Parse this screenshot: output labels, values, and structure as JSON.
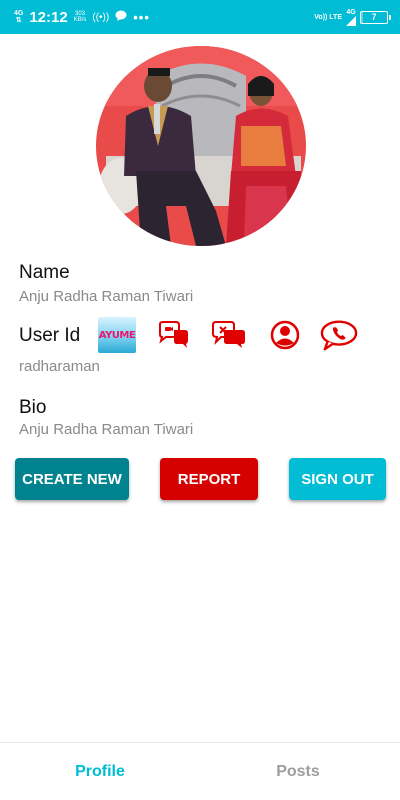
{
  "status_bar": {
    "network_left": "4G",
    "time": "12:12",
    "speed_value": "303",
    "speed_unit": "KB/s",
    "more_dots": "•••",
    "volte": "Vo)) LTE",
    "network_right": "4G",
    "battery": "7",
    "battery_level": 0.07
  },
  "profile": {
    "name_label": "Name",
    "name_value": "Anju Radha Raman Tiwari",
    "userid_label": "User Id",
    "userid_value": "radharaman",
    "bio_label": "Bio",
    "bio_value": "Anju Radha Raman Tiwari"
  },
  "icons": {
    "app_logo_text": "AYUME",
    "items": [
      "app-logo-icon",
      "video-chat-icon",
      "chat-icon",
      "user-icon",
      "call-chat-icon"
    ]
  },
  "buttons": {
    "create_new": "CREATE NEW",
    "report": "REPORT",
    "sign_out": "SIGN OUT"
  },
  "bottom_nav": {
    "profile": "Profile",
    "posts": "Posts"
  },
  "colors": {
    "accent": "#00bcd4",
    "create": "#00838f",
    "report": "#d50000",
    "icon_red": "#e00000"
  }
}
